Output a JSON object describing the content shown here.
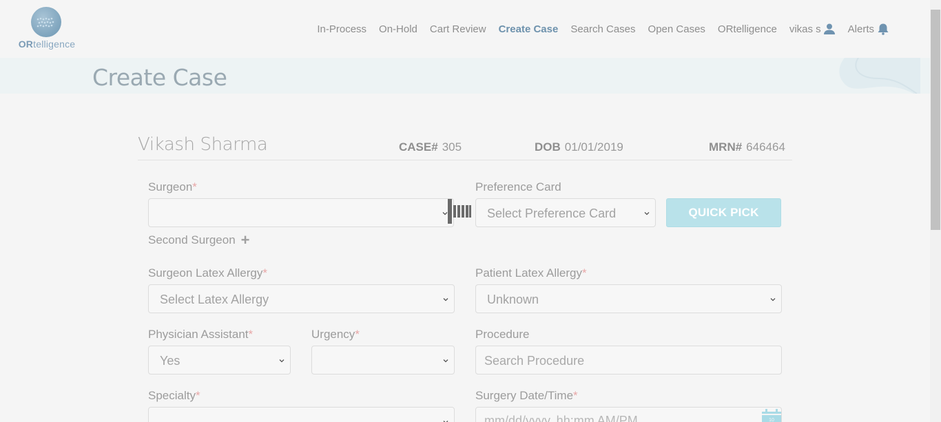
{
  "header": {
    "logo_text_bold": "OR",
    "logo_text_rest": "telligence",
    "nav": [
      {
        "label": "In-Process",
        "active": false
      },
      {
        "label": "On-Hold",
        "active": false
      },
      {
        "label": "Cart Review",
        "active": false
      },
      {
        "label": "Create Case",
        "active": true
      },
      {
        "label": "Search Cases",
        "active": false
      },
      {
        "label": "Open Cases",
        "active": false
      },
      {
        "label": "ORtelligence",
        "active": false
      },
      {
        "label": "vikas s",
        "icon": "user-icon"
      },
      {
        "label": "Alerts",
        "icon": "bell-icon"
      }
    ]
  },
  "page_title": "Create Case",
  "patient": {
    "name": "Vikash Sharma",
    "case_label": "CASE#",
    "case_value": "305",
    "dob_label": "DOB",
    "dob_value": "01/01/2019",
    "mrn_label": "MRN#",
    "mrn_value": "646464"
  },
  "form": {
    "surgeon": {
      "label": "Surgeon",
      "required": "*",
      "value": ""
    },
    "preference_card": {
      "label": "Preference Card",
      "value": "Select Preference Card"
    },
    "quick_pick": "QUICK PICK",
    "second_surgeon": "Second Surgeon",
    "surgeon_latex": {
      "label": "Surgeon Latex Allergy",
      "required": "*",
      "value": "Select Latex Allergy"
    },
    "patient_latex": {
      "label": "Patient Latex Allergy",
      "required": "*",
      "value": "Unknown"
    },
    "physician_assistant": {
      "label": "Physician Assistant",
      "required": "*",
      "value": "Yes"
    },
    "urgency": {
      "label": "Urgency",
      "required": "*",
      "value": ""
    },
    "procedure": {
      "label": "Procedure",
      "placeholder": "Search Procedure"
    },
    "specialty": {
      "label": "Specialty",
      "required": "*",
      "value": ""
    },
    "surgery_datetime": {
      "label": "Surgery Date/Time",
      "required": "*",
      "placeholder": "mm/dd/yyyy, hh:mm AM/PM"
    }
  },
  "colors": {
    "accent": "#6e92ad",
    "quick_pick_bg": "#b9e2ea",
    "required": "#e8a7a7"
  }
}
